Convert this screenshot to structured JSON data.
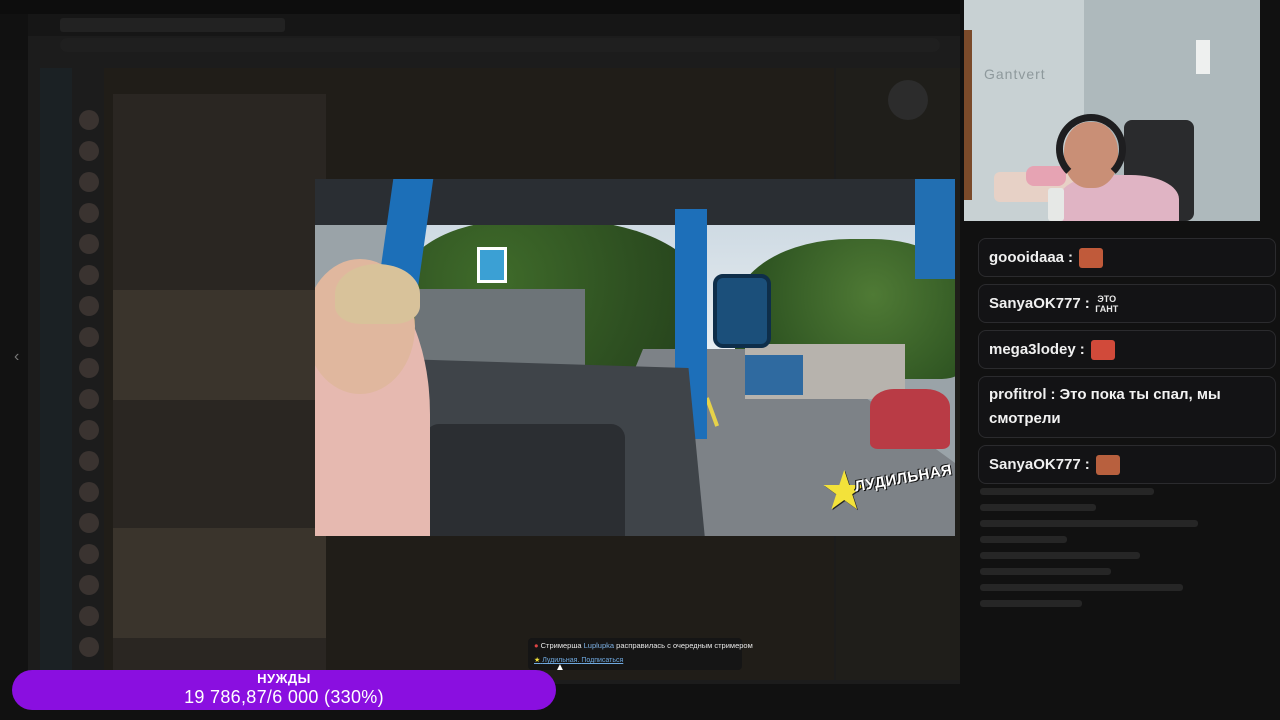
{
  "goal": {
    "title": "НУЖДЫ",
    "progress_text": "19 786,87/6 000 (330%)",
    "percent": 330,
    "color": "#8a0fe0"
  },
  "video": {
    "watermark_title": "ЛУДИЛЬНАЯ",
    "watermark_star_icon": "star-icon"
  },
  "chat": {
    "messages": [
      {
        "user": "goooidaaa",
        "text": "",
        "emote": "emote-face"
      },
      {
        "user": "SanyaOK777",
        "text": "",
        "emote_text": "ЭТО ГАНТ"
      },
      {
        "user": "mega3lodey",
        "text": "",
        "emote": "emote-face"
      },
      {
        "user": "profitrol",
        "text": "Это пока ты спал, мы смотрели"
      },
      {
        "user": "SanyaOK777",
        "text": "",
        "emote": "emote-face"
      }
    ]
  },
  "notification": {
    "prefix": "Стримерша",
    "name": "Luplupka",
    "suffix": "расправилась с очередным стримером",
    "channel": "Лудильная",
    "subscribe": "Подписаться"
  },
  "webcam": {
    "wall_sign": "Gantvert"
  }
}
